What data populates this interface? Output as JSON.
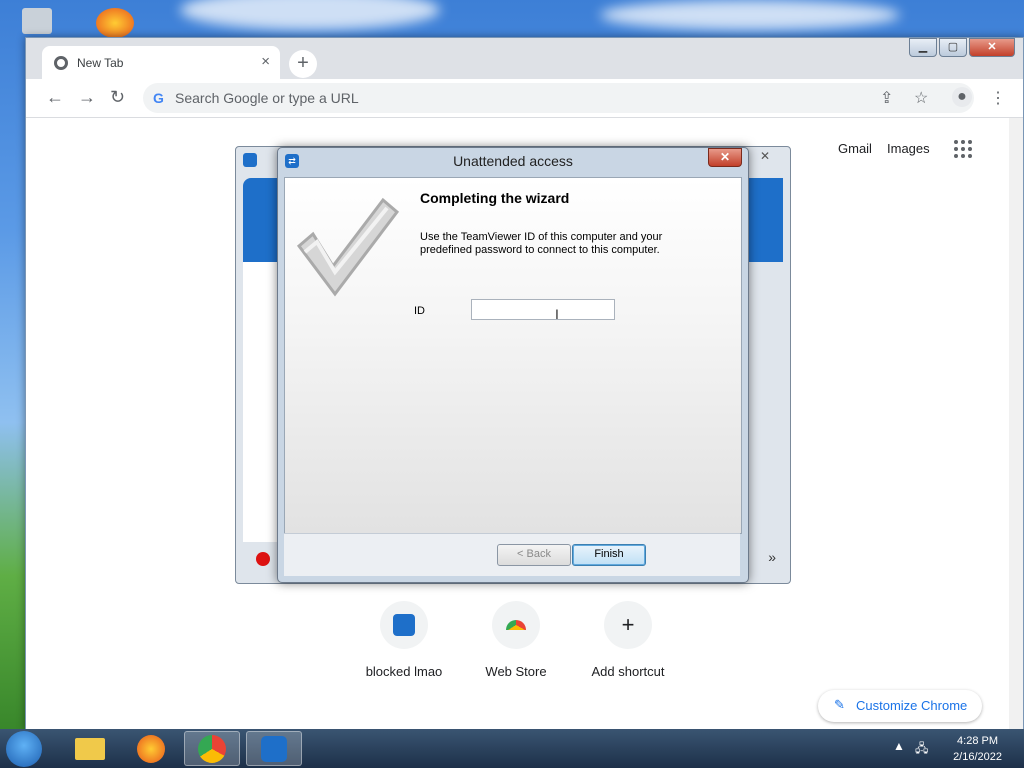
{
  "browser": {
    "tab_title": "New Tab",
    "tab_close": "×",
    "new_tab": "+",
    "omnibox_placeholder": "Search Google or type a URL",
    "omnibox_g": "G",
    "top_links": [
      "Gmail",
      "Images"
    ],
    "shortcuts": [
      {
        "label": "blocked lmao",
        "icon": "teamviewer-icon"
      },
      {
        "label": "Web Store",
        "icon": "web-store-icon"
      },
      {
        "label": "Add shortcut",
        "icon": "plus-icon",
        "glyph": "+"
      }
    ],
    "customize_label": "Customize Chrome"
  },
  "dialog": {
    "title": "Unattended access",
    "heading": "Completing the wizard",
    "description": "Use the TeamViewer ID of this computer and your predefined password to connect to this computer.",
    "id_label": "ID",
    "id_value": "",
    "back_button": "< Back",
    "finish_button": "Finish"
  },
  "taskbar": {
    "time": "4:28 PM",
    "date": "2/16/2022",
    "items": [
      "file-explorer-icon",
      "firefox-icon",
      "chrome-icon",
      "teamviewer-icon"
    ]
  },
  "colors": {
    "accent": "#1a73e8",
    "teamviewer_blue": "#1e6fc9",
    "close_red": "#c2402a"
  }
}
